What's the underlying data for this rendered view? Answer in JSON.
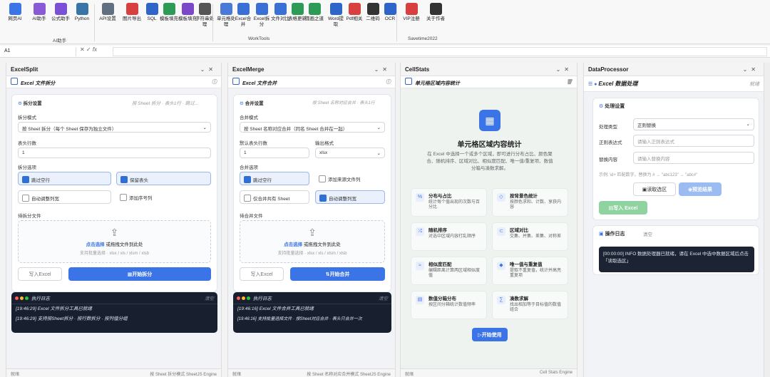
{
  "ribbon": {
    "buttons": [
      {
        "label": "网页AI",
        "icon": "globe-icon",
        "color": "#3b74e6"
      },
      {
        "label": "AI助手",
        "icon": "ai-icon",
        "color": "#8a5ad6"
      },
      {
        "label": "公式助手",
        "icon": "fx-icon",
        "color": "#7b4fd6"
      },
      {
        "label": "Python",
        "icon": "python-icon",
        "color": "#3a75a8"
      },
      {
        "label": "API设置",
        "icon": "gear-icon",
        "color": "#607080"
      },
      {
        "label": "图片导出",
        "icon": "image-icon",
        "color": "#d84040"
      },
      {
        "label": "SQL",
        "icon": "database-icon",
        "color": "#2f64c8"
      },
      {
        "label": "模板填充",
        "icon": "template-icon",
        "color": "#2d9a56"
      },
      {
        "label": "模板填充",
        "icon": "template-icon",
        "color": "#7a48c8"
      },
      {
        "label": "字符串处理",
        "icon": "pen-icon",
        "color": "#555"
      },
      {
        "label": "单元格处理",
        "icon": "grid-icon",
        "color": "#4a7ad8"
      },
      {
        "label": "Excel合并",
        "icon": "merge-icon",
        "color": "#3a6fd6"
      },
      {
        "label": "Excel拆分",
        "icon": "split-icon",
        "color": "#3a6fd6"
      },
      {
        "label": "文件对比",
        "icon": "compare-icon",
        "color": "#3a6fd6"
      },
      {
        "label": "表格更新",
        "icon": "refresh-icon",
        "color": "#2d9a56"
      },
      {
        "label": "圆画之道",
        "icon": "board-icon",
        "color": "#2d9a56"
      },
      {
        "label": "Word提取",
        "icon": "network-icon",
        "color": "#2f64c8"
      },
      {
        "label": "Pdf相关",
        "icon": "pdf-icon",
        "color": "#d84040"
      },
      {
        "label": "二维码",
        "icon": "qr-icon",
        "color": "#333"
      },
      {
        "label": "OCR",
        "icon": "ocr-icon",
        "color": "#2f64c8"
      },
      {
        "label": "VIP注册",
        "icon": "vip-icon",
        "color": "#d84040"
      },
      {
        "label": "关于作者",
        "icon": "person-icon",
        "color": "#333"
      }
    ],
    "groups": [
      "AI助手",
      "WorkTools",
      "Savetime2022"
    ]
  },
  "formula": {
    "cell": "A1",
    "fx": "fx"
  },
  "split": {
    "title": "ExcelSplit",
    "sub": "Excel 文件拆分",
    "settings": "拆分设置",
    "settings_hint": "按 Sheet 拆分 · 表头1行 · 跳过...",
    "mode_label": "拆分模式",
    "mode_value": "按 Sheet 拆分（每个 Sheet 保存为独立文件）",
    "rows_label": "表头行数",
    "rows_value": "1",
    "opt_label": "拆分选项",
    "opts": [
      "跳过空行",
      "保留表头",
      "自动调整列宽",
      "添加序号列"
    ],
    "file_label": "待拆分文件",
    "drop_link": "点击选择",
    "drop_text": "或拖拽文件到此处",
    "drop_hint": "支持批量选择 · xlsx / xls / xlsm / xlsb",
    "write_btn": "写入Excel",
    "run_btn": "开始拆分",
    "log_title": "执行日志",
    "log_clear": "清空",
    "logs": [
      "[19:46:29] Excel 文件拆分工具已就绪",
      "[19:46:29] 支持按Sheet拆分 · 按行数拆分 · 按列值分组"
    ],
    "status_l": "就绪",
    "status_r": "按 Sheet 拆分模式  SheetJS Engine"
  },
  "merge": {
    "title": "ExcelMerge",
    "sub": "Excel 文件合并",
    "settings": "合并设置",
    "settings_hint": "按 Sheet 名称对应合并 · 表头1行",
    "mode_label": "合并模式",
    "mode_value": "按 Sheet 名称对应合并（同名 Sheet 合并在一起）",
    "rows_label": "默认表头行数",
    "rows_value": "1",
    "fmt_label": "输出格式",
    "fmt_value": "xlsx",
    "opt_label": "合并选项",
    "opts": [
      "跳过空行",
      "添加来源文件列",
      "仅合并共有 Sheet",
      "自动调整列宽"
    ],
    "file_label": "待合并文件",
    "drop_link": "点击选择",
    "drop_text": "或拖拽文件到此处",
    "drop_hint": "支持批量选择 · xlsx / xls / xlsm / xlsb",
    "write_btn": "写入Excel",
    "run_btn": "开始合并",
    "log_title": "执行日志",
    "log_clear": "清空",
    "logs": [
      "[19:46:16] Excel 文件合并工具已就绪",
      "[19:46:16] 支持批量选择文件 · 按Sheet对应合并 · 表头只合并一次"
    ],
    "status_l": "就绪",
    "status_r": "按 Sheet 名称对应合并模式  SheetJS Engine"
  },
  "stats": {
    "title": "CellStats",
    "sub": "单元格区域内容统计",
    "heading": "单元格区域内容统计",
    "desc": "在 Excel 中选择一个或多个区域，即可进行分布占比、颜色聚合、随机排序、区域对比、相似度匹配、唯一值/重复项、数值分箱与凑数求解。",
    "features": [
      {
        "t": "分布与占比",
        "d": "统计每个值出现的次数与百分比",
        "i": "%"
      },
      {
        "t": "按背景色统计",
        "d": "按颜色求和、计数、享获内容",
        "i": "◇"
      },
      {
        "t": "随机排序",
        "d": "对选中区域内容打乱顺序",
        "i": "⤮"
      },
      {
        "t": "区域对比",
        "d": "交集、并集、差集、对称差",
        "i": "⊂"
      },
      {
        "t": "相似度匹配",
        "d": "编辑距离计算两区域相似度值",
        "i": "≈"
      },
      {
        "t": "唯一值与重复值",
        "d": "提取不重复值，统计并高亮重复项",
        "i": "◆"
      },
      {
        "t": "数值分箱分布",
        "d": "按区间分箱统计数值频率",
        "i": "▤"
      },
      {
        "t": "凑数求解",
        "d": "找出相加等于目标值的数值组合",
        "i": "∑"
      }
    ],
    "start_btn": "开始使用",
    "status_l": "就绪",
    "status_r": "Cell Stats Engine"
  },
  "dp": {
    "title": "DataProcessor",
    "sub": "Excel 数据处理",
    "sub_right": "就绪",
    "settings": "处理设置",
    "type_label": "处理类型",
    "type_value": "正则替换",
    "regex_label": "正则表达式",
    "regex_ph": "请输入正则表达式",
    "repl_label": "替换内容",
    "repl_ph": "请输入替换内容",
    "example": "示例: \\d+ 匹配数字，替换为 # → \"abc123\" → \"abc#\"",
    "read_btn": "读取选区",
    "preview_btn": "预览结果",
    "write_btn": "写入 Excel",
    "log_title": "操作日志",
    "log_clear": "清空",
    "log": "[00:00:00] INFO 数据处理器已就绪，请在 Excel 中选中数据区域后点击「读取选区」"
  }
}
